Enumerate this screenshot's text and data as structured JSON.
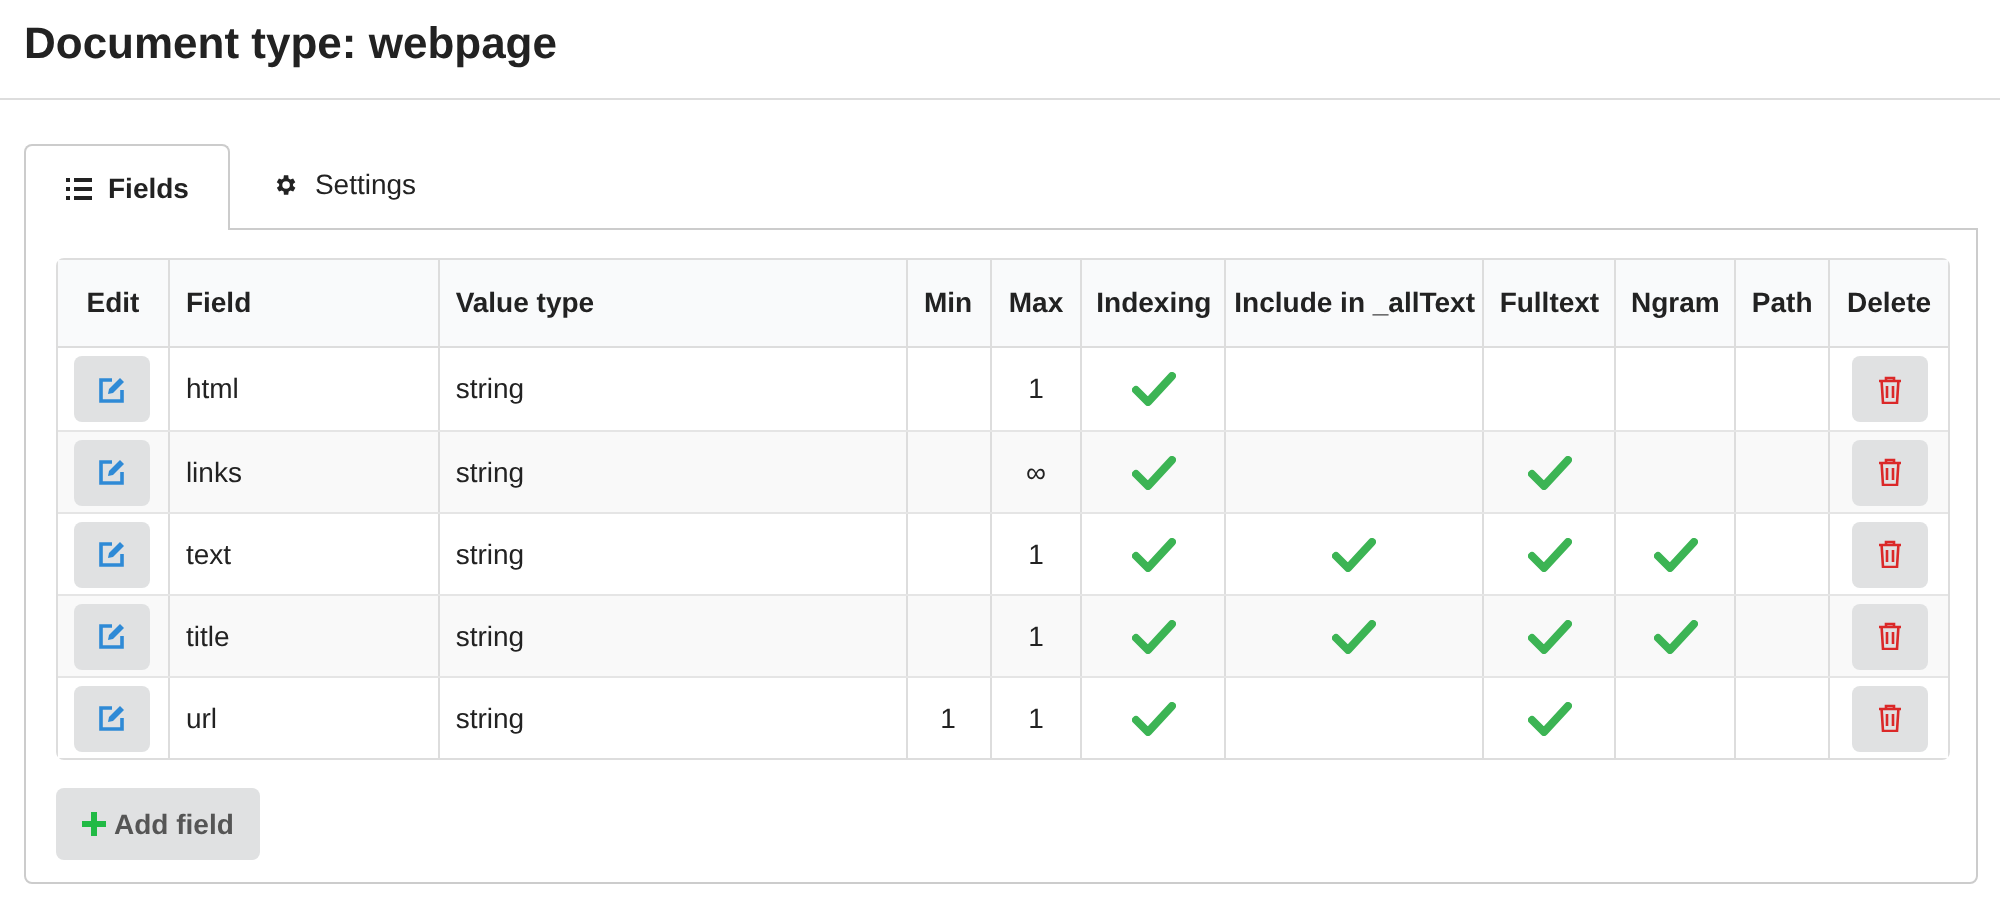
{
  "title": "Document type: webpage",
  "tabs": [
    {
      "label": "Fields",
      "selected": true,
      "kind": "list"
    },
    {
      "label": "Settings",
      "selected": false,
      "kind": "gear"
    }
  ],
  "table": {
    "columns": [
      "Edit",
      "Field",
      "Value type",
      "Min",
      "Max",
      "Indexing",
      "Include in _allText",
      "Fulltext",
      "Ngram",
      "Path",
      "Delete"
    ],
    "rows": [
      {
        "field": "html",
        "value_type": "string",
        "min": "",
        "max": "1",
        "indexing": true,
        "include_in_alltext": false,
        "fulltext": false,
        "ngram": false,
        "path": false
      },
      {
        "field": "links",
        "value_type": "string",
        "min": "",
        "max": "∞",
        "indexing": true,
        "include_in_alltext": false,
        "fulltext": true,
        "ngram": false,
        "path": false
      },
      {
        "field": "text",
        "value_type": "string",
        "min": "",
        "max": "1",
        "indexing": true,
        "include_in_alltext": true,
        "fulltext": true,
        "ngram": true,
        "path": false
      },
      {
        "field": "title",
        "value_type": "string",
        "min": "",
        "max": "1",
        "indexing": true,
        "include_in_alltext": true,
        "fulltext": true,
        "ngram": true,
        "path": false
      },
      {
        "field": "url",
        "value_type": "string",
        "min": "1",
        "max": "1",
        "indexing": true,
        "include_in_alltext": false,
        "fulltext": true,
        "ngram": false,
        "path": false
      }
    ]
  },
  "add_button": "Add field"
}
